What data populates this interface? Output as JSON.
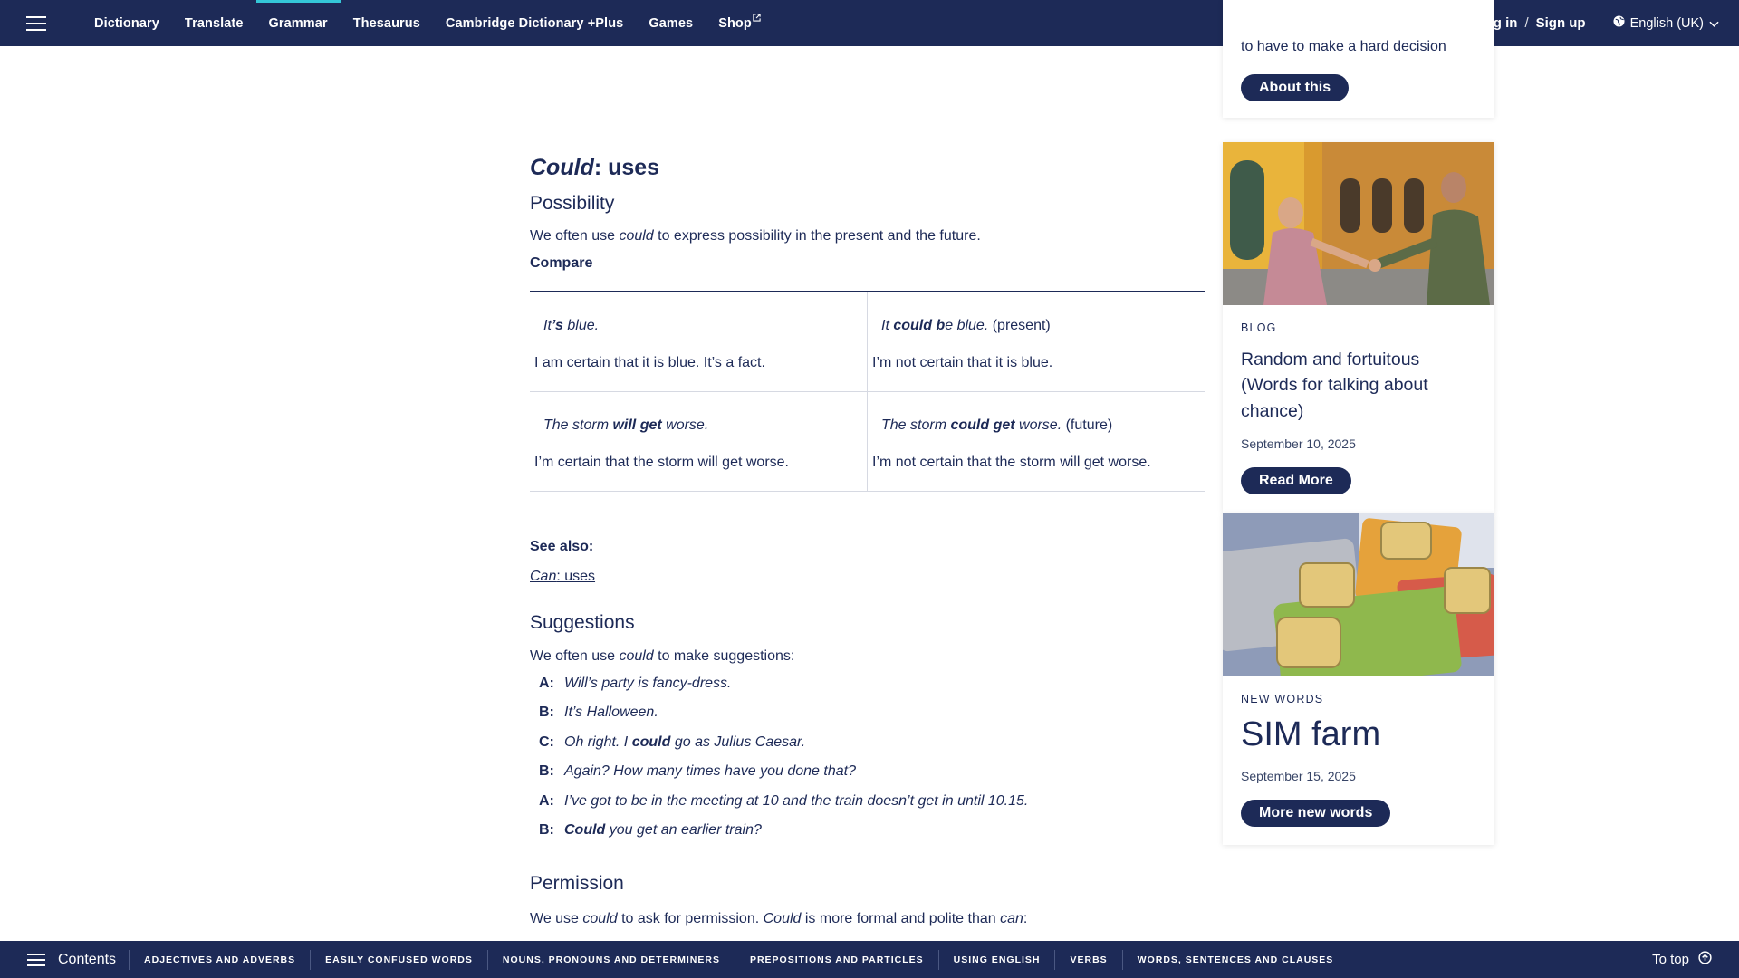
{
  "topbar": {
    "nav": [
      {
        "label": "Dictionary",
        "active": false
      },
      {
        "label": "Translate",
        "active": false
      },
      {
        "label": "Grammar",
        "active": true
      },
      {
        "label": "Thesaurus",
        "active": false
      },
      {
        "label": "Cambridge Dictionary +Plus",
        "active": false
      },
      {
        "label": "Games",
        "active": false
      },
      {
        "label": "Shop",
        "active": false
      }
    ],
    "social": [
      "facebook-icon",
      "instagram-icon",
      "x-icon"
    ],
    "login": "Log in",
    "slash": "/",
    "signup": "Sign up",
    "language": "English (UK)"
  },
  "article": {
    "title_word": "Could",
    "title_rest": ": uses",
    "possibility": {
      "heading": "Possibility",
      "intro_pre": "We often use ",
      "intro_word": "could",
      "intro_post": " to express possibility in the present and the future.",
      "compare_label": "Compare"
    },
    "table": [
      {
        "left_ex_parts": [
          "It",
          "’s",
          " blue."
        ],
        "left_desc": "I am certain that it is blue. It’s a fact.",
        "right_ex_parts": [
          "It ",
          "could b",
          "e blue.",
          " (present)"
        ],
        "right_desc": "I’m not certain that it is blue."
      },
      {
        "left_ex_parts": [
          "The storm ",
          "will get",
          " worse."
        ],
        "left_desc": "I’m certain that the storm will get worse.",
        "right_ex_parts": [
          "The storm ",
          "could get",
          " worse.",
          " (future)"
        ],
        "right_desc": "I’m not certain that the storm will get worse."
      }
    ],
    "see_also_label": "See also:",
    "see_also_link_word": "Can",
    "see_also_link_rest": ": uses",
    "suggestions": {
      "heading": "Suggestions",
      "intro_pre": "We often use ",
      "intro_word": "could",
      "intro_post": " to make suggestions:",
      "dialog": [
        {
          "speaker": "A:",
          "pre": "Will’s party is fancy-dress.",
          "bold": "",
          "post": ""
        },
        {
          "speaker": "B:",
          "pre": "It’s Halloween.",
          "bold": "",
          "post": ""
        },
        {
          "speaker": "C:",
          "pre": "Oh right. I ",
          "bold": "could",
          "post": " go as Julius Caesar."
        },
        {
          "speaker": "B:",
          "pre": "Again? How many times have you done that?",
          "bold": "",
          "post": ""
        },
        {
          "speaker": "A:",
          "pre": "I’ve got to be in the meeting at 10 and the train doesn’t get in until 10.15.",
          "bold": "",
          "post": ""
        },
        {
          "speaker": "B:",
          "pre": "",
          "bold": "Could",
          "post": " you get an earlier train?"
        }
      ]
    },
    "permission": {
      "heading": "Permission",
      "p1": "We use ",
      "w1": "could",
      "p2": " to ask for permission. ",
      "w2": "Could",
      "p3": " is more formal and polite than ",
      "w3": "can",
      "p4": ":"
    }
  },
  "sidebar": {
    "top_card": {
      "partial_text": "to have to make a hard decision",
      "button": "About this"
    },
    "blog_card": {
      "kicker": "BLOG",
      "title": "Random and fortuitous (Words for talking about chance)",
      "date": "September 10, 2025",
      "button": "Read More"
    },
    "new_words_card": {
      "kicker": "NEW WORDS",
      "title": "SIM farm",
      "date": "September 15, 2025",
      "button": "More new words"
    }
  },
  "bottombar": {
    "contents_label": "Contents",
    "links": [
      "ADJECTIVES AND ADVERBS",
      "EASILY CONFUSED WORDS",
      "NOUNS, PRONOUNS AND DETERMINERS",
      "PREPOSITIONS AND PARTICLES",
      "USING ENGLISH",
      "VERBS",
      "WORDS, SENTENCES AND CLAUSES"
    ],
    "to_top": "To top"
  },
  "colors": {
    "brand_navy": "#1d2a57",
    "accent_teal": "#34c7d8"
  }
}
